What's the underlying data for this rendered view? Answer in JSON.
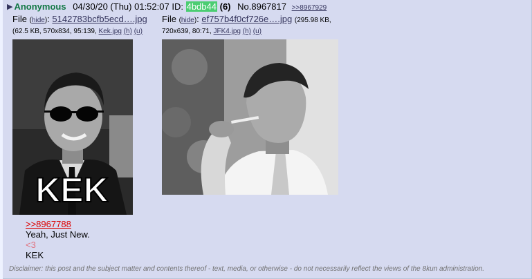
{
  "post": {
    "triangle": "▶",
    "name": "Anonymous",
    "date": "04/30/20 (Thu) 01:52:07",
    "id_label": "ID:",
    "id_value": "4bdb44",
    "id_count": "(6)",
    "post_number": "No.8967817",
    "backlink": ">>8967929"
  },
  "files": [
    {
      "label": "File",
      "hide": "hide",
      "filename": "5142783bcfb5ecd….jpg",
      "meta_prefix": "(62.5 KB, 570x834, 95:139,",
      "orig_name": "Kek.jpg",
      "h": "(h)",
      "u": "(u)",
      "image_text": "KEK"
    },
    {
      "label": "File",
      "hide": "hide",
      "filename": "ef757b4f0cf726e….jpg",
      "size": "(295.98 KB,",
      "meta_prefix": "720x639, 80:71,",
      "orig_name": "JFK4.jpg",
      "h": "(h)",
      "u": "(u)"
    }
  ],
  "body": {
    "quote_link": ">>8967788",
    "line1": "Yeah, Just New.",
    "line2": "<3",
    "line3": "KEK"
  },
  "disclaimer": "Disclaimer: this post and the subject matter and contents thereof - text, media, or otherwise - do not necessarily reflect the views of the 8kun administration."
}
